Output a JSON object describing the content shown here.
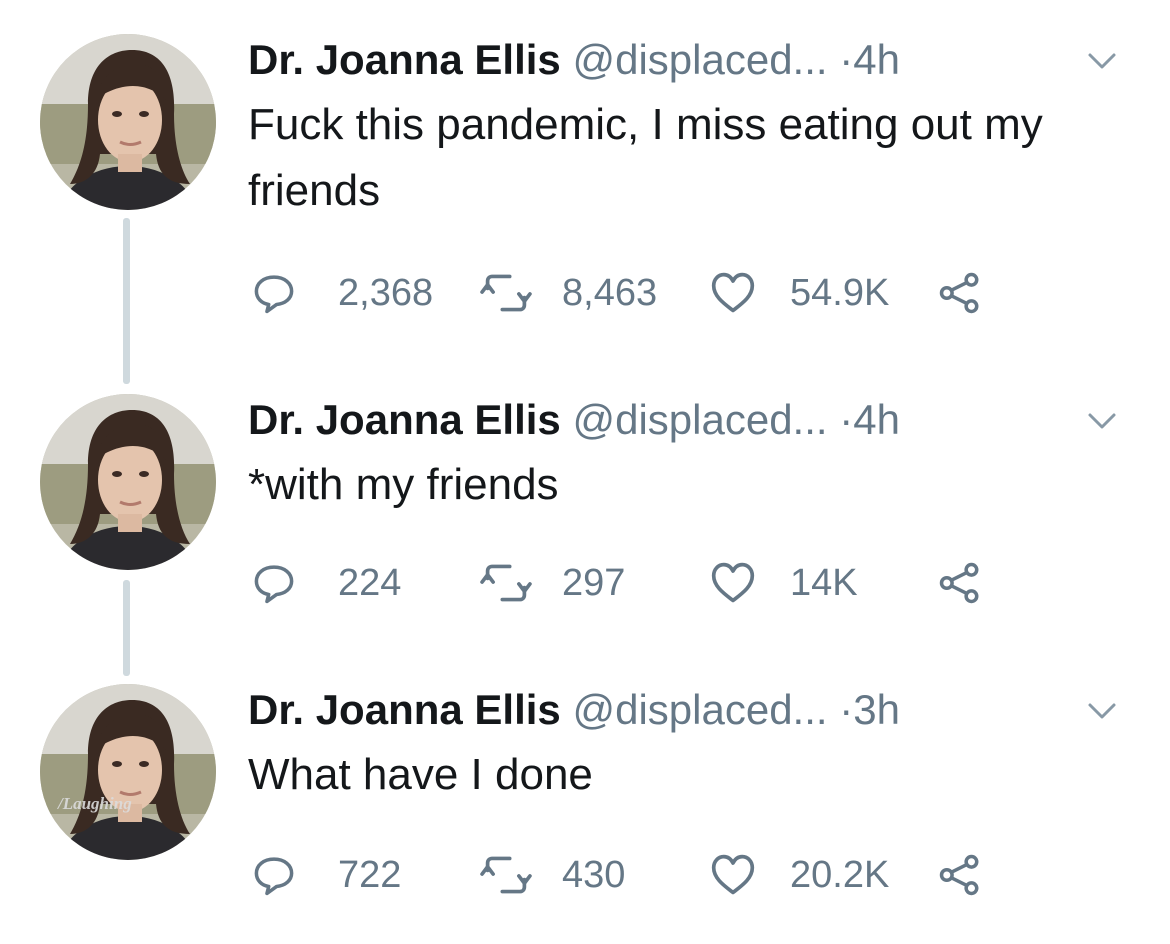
{
  "tweets": [
    {
      "name": "Dr. Joanna Ellis",
      "handle": "@displaced...",
      "separator": "·",
      "time": "4h",
      "text": "Fuck this pandemic, I miss eating out my friends",
      "replies": "2,368",
      "retweets": "8,463",
      "likes": "54.9K"
    },
    {
      "name": "Dr. Joanna Ellis",
      "handle": "@displaced...",
      "separator": "·",
      "time": "4h",
      "text": "*with my friends",
      "replies": "224",
      "retweets": "297",
      "likes": "14K"
    },
    {
      "name": "Dr. Joanna Ellis",
      "handle": "@displaced...",
      "separator": "·",
      "time": "3h",
      "text": "What have I done",
      "replies": "722",
      "retweets": "430",
      "likes": "20.2K"
    }
  ],
  "watermark": "/Laughing",
  "icons": {
    "reply": "reply-icon",
    "retweet": "retweet-icon",
    "like": "heart-icon",
    "share": "share-icon",
    "more": "chevron-down-icon"
  },
  "colors": {
    "text": "#14171a",
    "secondary": "#657786",
    "thread_line": "#cfd9de"
  }
}
